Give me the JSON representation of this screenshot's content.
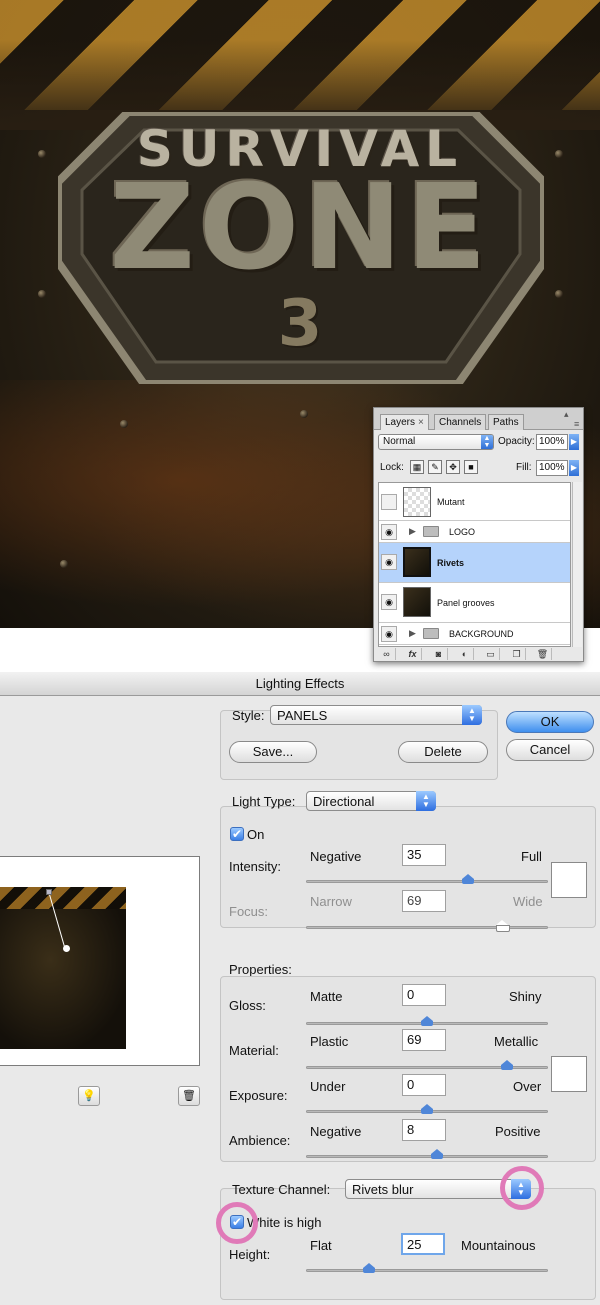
{
  "artwork": {
    "line1": "SURVIVAL",
    "line2": "ZONE",
    "line3": "3"
  },
  "layers_panel": {
    "tabs": [
      {
        "label": "Layers",
        "active": true,
        "close": "×"
      },
      {
        "label": "Channels",
        "active": false
      },
      {
        "label": "Paths",
        "active": false
      }
    ],
    "blend_mode": "Normal",
    "opacity_label": "Opacity:",
    "opacity_value": "100%",
    "lock_label": "Lock:",
    "fill_label": "Fill:",
    "fill_value": "100%",
    "layers": [
      {
        "name": "Mutant",
        "visible": false,
        "type": "layer",
        "selected": false
      },
      {
        "name": "LOGO",
        "visible": true,
        "type": "group",
        "selected": false
      },
      {
        "name": "Rivets",
        "visible": true,
        "type": "layer",
        "selected": true
      },
      {
        "name": "Panel grooves",
        "visible": true,
        "type": "layer",
        "selected": false
      },
      {
        "name": "BACKGROUND",
        "visible": true,
        "type": "group",
        "selected": false
      }
    ],
    "bottom_icons": [
      "link-icon",
      "fx-icon",
      "mask-icon",
      "adjustment-icon",
      "folder-icon",
      "new-layer-icon",
      "trash-icon"
    ]
  },
  "dialog": {
    "title": "Lighting Effects",
    "style_label": "Style:",
    "style_value": "PANELS",
    "save_label": "Save...",
    "delete_label": "Delete",
    "ok_label": "OK",
    "cancel_label": "Cancel",
    "light_type_label": "Light Type:",
    "light_type_value": "Directional",
    "on_label": "On",
    "on_checked": true,
    "intensity": {
      "label": "Intensity:",
      "min": "Negative",
      "max": "Full",
      "value": "35",
      "fraction": 0.67
    },
    "focus": {
      "label": "Focus:",
      "min": "Narrow",
      "max": "Wide",
      "value": "69",
      "fraction": 0.81
    },
    "properties_label": "Properties:",
    "gloss": {
      "label": "Gloss:",
      "min": "Matte",
      "max": "Shiny",
      "value": "0",
      "fraction": 0.5
    },
    "material": {
      "label": "Material:",
      "min": "Plastic",
      "max": "Metallic",
      "value": "69",
      "fraction": 0.83
    },
    "exposure": {
      "label": "Exposure:",
      "min": "Under",
      "max": "Over",
      "value": "0",
      "fraction": 0.5
    },
    "ambience": {
      "label": "Ambience:",
      "min": "Negative",
      "max": "Positive",
      "value": "8",
      "fraction": 0.54
    },
    "texture_channel_label": "Texture Channel:",
    "texture_channel_value": "Rivets blur",
    "white_is_high_label": "White is high",
    "white_is_high_checked": true,
    "height": {
      "label": "Height:",
      "min": "Flat",
      "max": "Mountainous",
      "value": "25",
      "fraction": 0.26
    },
    "highlight_color": "#e07ab8",
    "accent_color": "#3b7fe6"
  }
}
